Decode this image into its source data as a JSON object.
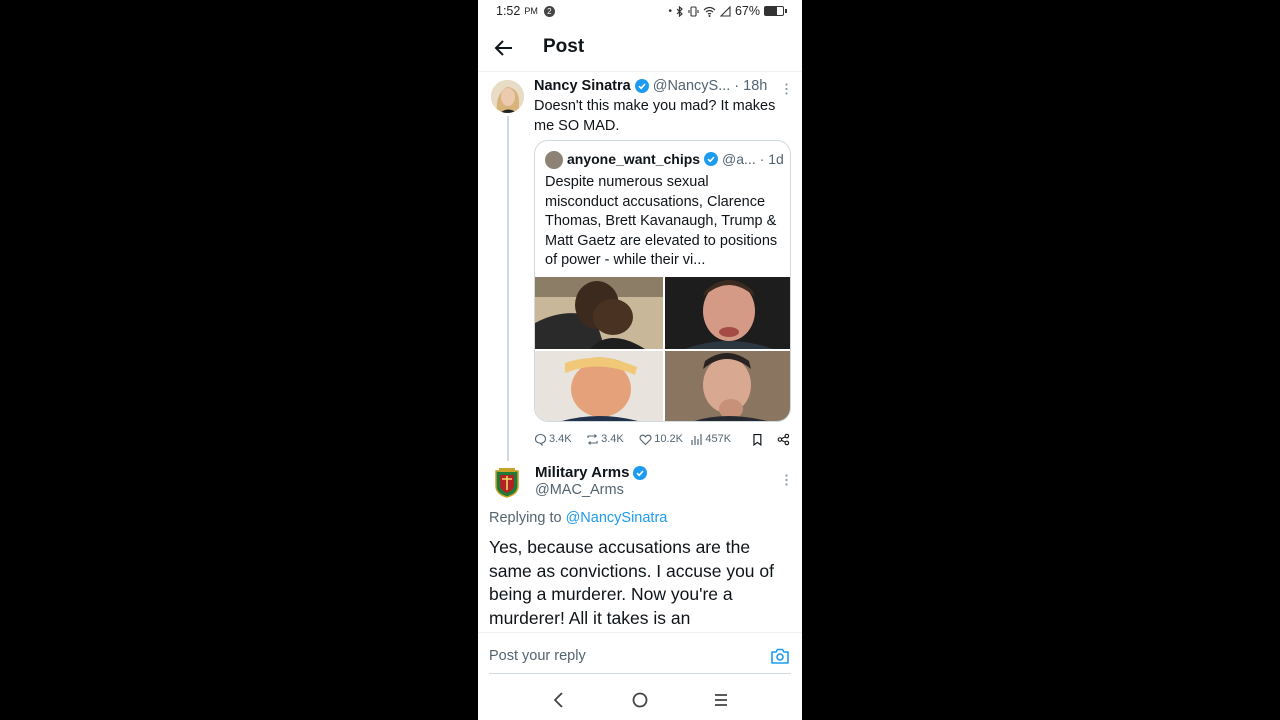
{
  "status_bar": {
    "time": "1:52",
    "ampm": "PM",
    "notification_count": "2",
    "battery_percent": "67%",
    "battery_level": 0.67
  },
  "header": {
    "title": "Post",
    "back_icon": "arrow-left-icon"
  },
  "post": {
    "name": "Nancy Sinatra",
    "handle": "@NancyS...",
    "time": "· 18h",
    "text": "Doesn't this make you mad? It makes me SO MAD.",
    "quote": {
      "name": "anyone_want_chips",
      "handle": "@a...",
      "time": "· 1d",
      "text": "Despite numerous sexual misconduct accusations, Clarence Thomas, Brett Kavanaugh, Trump & Matt Gaetz are elevated to positions of power - while their vi..."
    },
    "actions": {
      "replies": "3.4K",
      "reposts": "3.4K",
      "likes": "10.2K",
      "views": "457K"
    }
  },
  "reply": {
    "name": "Military Arms",
    "handle": "@MAC_Arms",
    "replying_prefix": "Replying to",
    "replying_to": "@NancySinatra",
    "text": "Yes, because accusations are the same as convictions. I accuse you of being a murderer. Now you're a murderer! All it takes is an"
  },
  "reply_bar": {
    "placeholder": "Post your reply"
  },
  "colors": {
    "accent": "#1d9bf0",
    "secondary_text": "#536471"
  }
}
